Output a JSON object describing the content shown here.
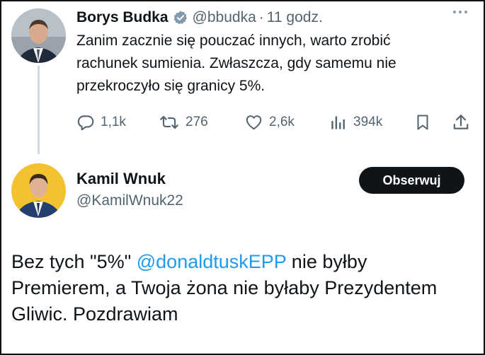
{
  "tweet1": {
    "author_name": "Borys Budka",
    "handle": "@bbudka",
    "separator": "·",
    "time": "11 godz.",
    "text": "Zanim zacznie się pouczać innych, warto zrobić\nrachunek sumienia. Zwłaszcza, gdy samemu nie\nprzekroczyło się granicy 5%.",
    "actions": {
      "reply_count": "1,1k",
      "retweet_count": "276",
      "like_count": "2,6k",
      "views_count": "394k"
    },
    "icons": [
      "verified-badge-icon",
      "more-icon",
      "reply-icon",
      "retweet-icon",
      "like-icon",
      "views-icon",
      "bookmark-icon",
      "share-icon"
    ]
  },
  "tweet2": {
    "author_name": "Kamil Wnuk",
    "handle": "@KamilWnuk22",
    "follow_label": "Obserwuj",
    "text_before": "Bez tych \"5%\" ",
    "mention": "@donaldtuskEPP",
    "text_after": " nie byłby Premierem, a Twoja żona nie byłaby Prezydentem Gliwic. Pozdrawiam"
  },
  "colors": {
    "text": "#0f1419",
    "secondary": "#536471",
    "link": "#1d9bf0",
    "verified": "#829aab",
    "button_bg": "#0f1419"
  }
}
